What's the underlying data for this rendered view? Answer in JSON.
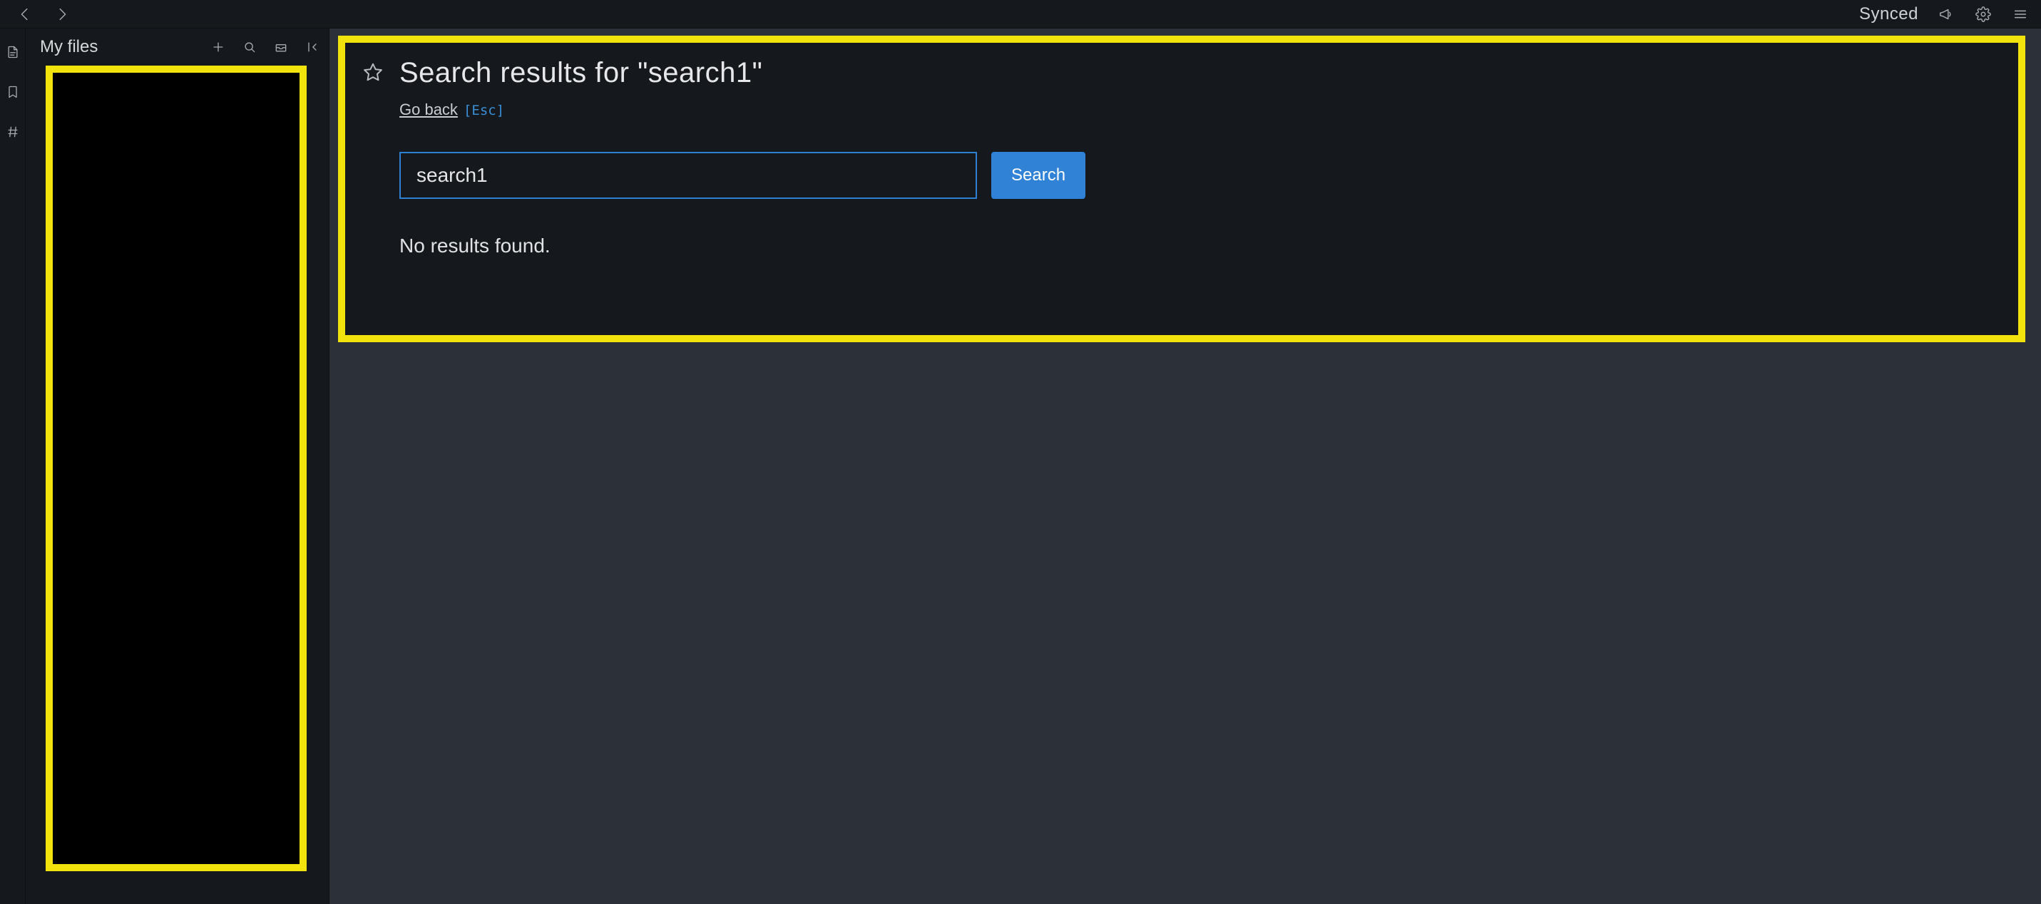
{
  "topbar": {
    "sync_status": "Synced"
  },
  "sidebar": {
    "title": "My files"
  },
  "search": {
    "title": "Search results for \"search1\"",
    "go_back_label": "Go back",
    "esc_hint": "[Esc]",
    "input_value": "search1",
    "search_button_label": "Search",
    "no_results_text": "No results found."
  }
}
